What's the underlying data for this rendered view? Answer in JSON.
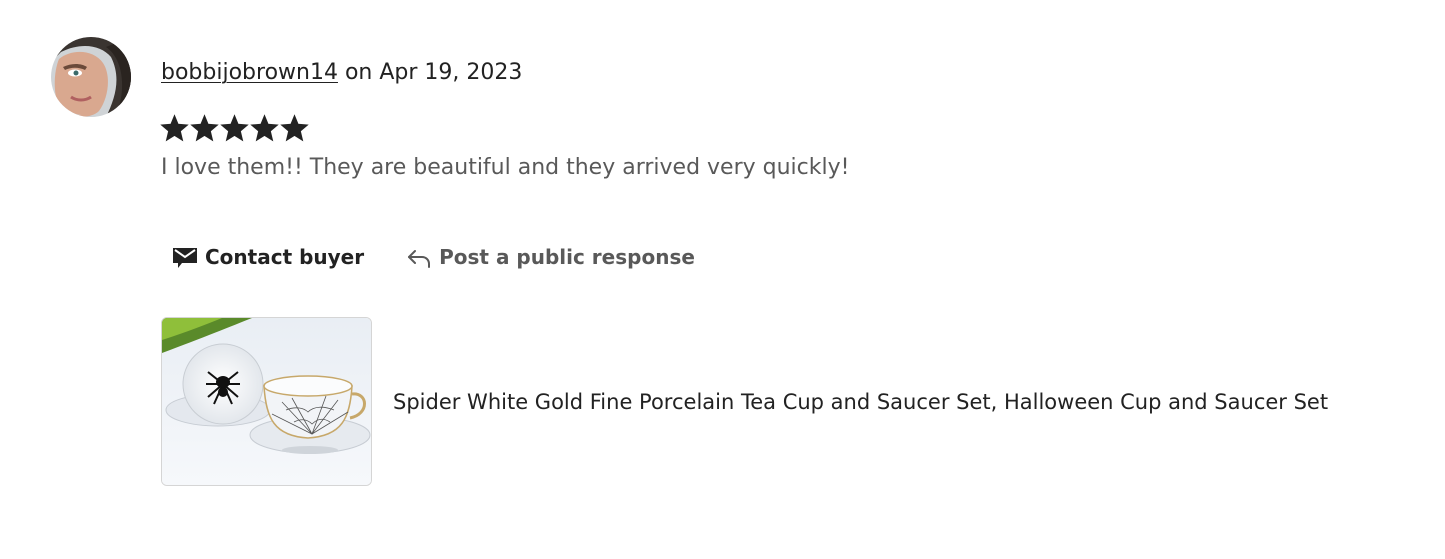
{
  "review": {
    "reviewer_name": "bobbijobrown14",
    "date_prefix": " on ",
    "date": "Apr 19, 2023",
    "rating": 5,
    "rating_max": 5,
    "text": "I love them!! They are beautiful and they arrived very quickly!"
  },
  "actions": {
    "contact_label": "Contact buyer",
    "contact_icon": "envelope-icon",
    "respond_label": "Post a public response",
    "respond_icon": "reply-arrow-icon"
  },
  "listing": {
    "title": "Spider White Gold Fine Porcelain Tea Cup and Saucer Set, Halloween Cup and Saucer Set"
  },
  "colors": {
    "primary_text": "#222222",
    "secondary_text": "#595959",
    "star": "#222222",
    "border": "#d5d5d5"
  }
}
